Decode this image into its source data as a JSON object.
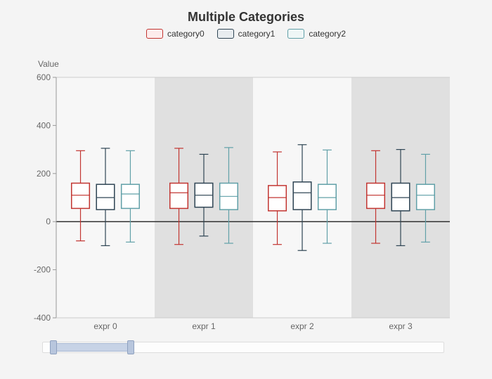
{
  "title": "Multiple Categories",
  "y_axis_label": "Value",
  "legend": [
    {
      "name": "category0",
      "swatch": "sw-red"
    },
    {
      "name": "category1",
      "swatch": "sw-navy"
    },
    {
      "name": "category2",
      "swatch": "sw-teal"
    }
  ],
  "chart_data": {
    "type": "box",
    "title": "Multiple Categories",
    "ylabel": "Value",
    "ylim": [
      -400,
      600
    ],
    "yticks": [
      -400,
      -200,
      0,
      200,
      400,
      600
    ],
    "categories": [
      "expr 0",
      "expr 1",
      "expr 2",
      "expr 3"
    ],
    "series": [
      {
        "name": "category0",
        "color": "#c23531",
        "boxes": [
          {
            "min": -80,
            "q1": 55,
            "median": 110,
            "q3": 160,
            "max": 295
          },
          {
            "min": -95,
            "q1": 55,
            "median": 120,
            "q3": 160,
            "max": 305
          },
          {
            "min": -95,
            "q1": 45,
            "median": 100,
            "q3": 150,
            "max": 290
          },
          {
            "min": -90,
            "q1": 55,
            "median": 110,
            "q3": 160,
            "max": 295
          }
        ]
      },
      {
        "name": "category1",
        "color": "#2f4554",
        "boxes": [
          {
            "min": -100,
            "q1": 50,
            "median": 100,
            "q3": 155,
            "max": 305
          },
          {
            "min": -60,
            "q1": 60,
            "median": 110,
            "q3": 160,
            "max": 280
          },
          {
            "min": -120,
            "q1": 50,
            "median": 120,
            "q3": 165,
            "max": 320
          },
          {
            "min": -100,
            "q1": 45,
            "median": 100,
            "q3": 160,
            "max": 300
          }
        ]
      },
      {
        "name": "category2",
        "color": "#61a0a8",
        "boxes": [
          {
            "min": -85,
            "q1": 55,
            "median": 115,
            "q3": 155,
            "max": 295
          },
          {
            "min": -90,
            "q1": 50,
            "median": 105,
            "q3": 160,
            "max": 308
          },
          {
            "min": -90,
            "q1": 50,
            "median": 100,
            "q3": 155,
            "max": 298
          },
          {
            "min": -85,
            "q1": 50,
            "median": 110,
            "q3": 155,
            "max": 280
          }
        ]
      }
    ],
    "zoom": {
      "start_index": 0,
      "end_index": 3,
      "total_groups_hinted": 20
    }
  }
}
